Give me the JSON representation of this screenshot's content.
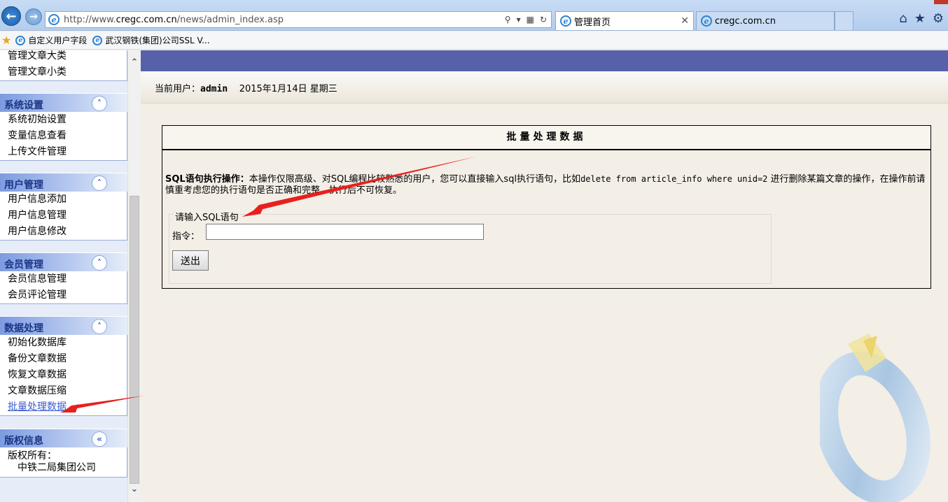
{
  "browser": {
    "url_prefix": "http://www.",
    "url_domain": "cregc.com.cn",
    "url_path": "/news/admin_index.asp",
    "tabs": [
      {
        "title": "管理首页",
        "active": true
      },
      {
        "title": "cregc.com.cn",
        "active": false
      }
    ],
    "favorites": [
      "自定义用户字段",
      "武汉钢铁(集团)公司SSL V..."
    ]
  },
  "sidebar": {
    "article_items": [
      "管理文章大类",
      "管理文章小类"
    ],
    "sections": [
      {
        "title": "系统设置",
        "items": [
          "系统初始设置",
          "变量信息查看",
          "上传文件管理"
        ]
      },
      {
        "title": "用户管理",
        "items": [
          "用户信息添加",
          "用户信息管理",
          "用户信息修改"
        ]
      },
      {
        "title": "会员管理",
        "items": [
          "会员信息管理",
          "会员评论管理"
        ]
      },
      {
        "title": "数据处理",
        "items": [
          "初始化数据库",
          "备份文章数据",
          "恢复文章数据",
          "文章数据压缩",
          "批量处理数据"
        ]
      }
    ],
    "copyright": {
      "title": "版权信息",
      "label": "版权所有：",
      "owner": "中铁二局集团公司"
    }
  },
  "main": {
    "user_label": "当前用户：",
    "user_name": "admin",
    "date": "2015年1月14日 星期三",
    "panel_title": "批量处理数据",
    "desc_bold": "SQL语句执行操作：",
    "desc_part1": "本操作仅限高级、对SQL编程比较熟悉的用户，您可以直接输入sql执行语句，比如",
    "desc_code": "delete from article_info where unid=2",
    "desc_part2": "进行删除某篇文章的操作，在操作前请慎重考虑您的执行语句是否正确和完整，执行后不可恢复。",
    "legend": "请输入SQL语句",
    "command_label": "指令：",
    "command_value": "",
    "submit_label": "送出"
  },
  "colors": {
    "top_band": "#5761aa",
    "annotation_arrow": "#e8201d",
    "sidebar_header": "#7d9be0"
  }
}
